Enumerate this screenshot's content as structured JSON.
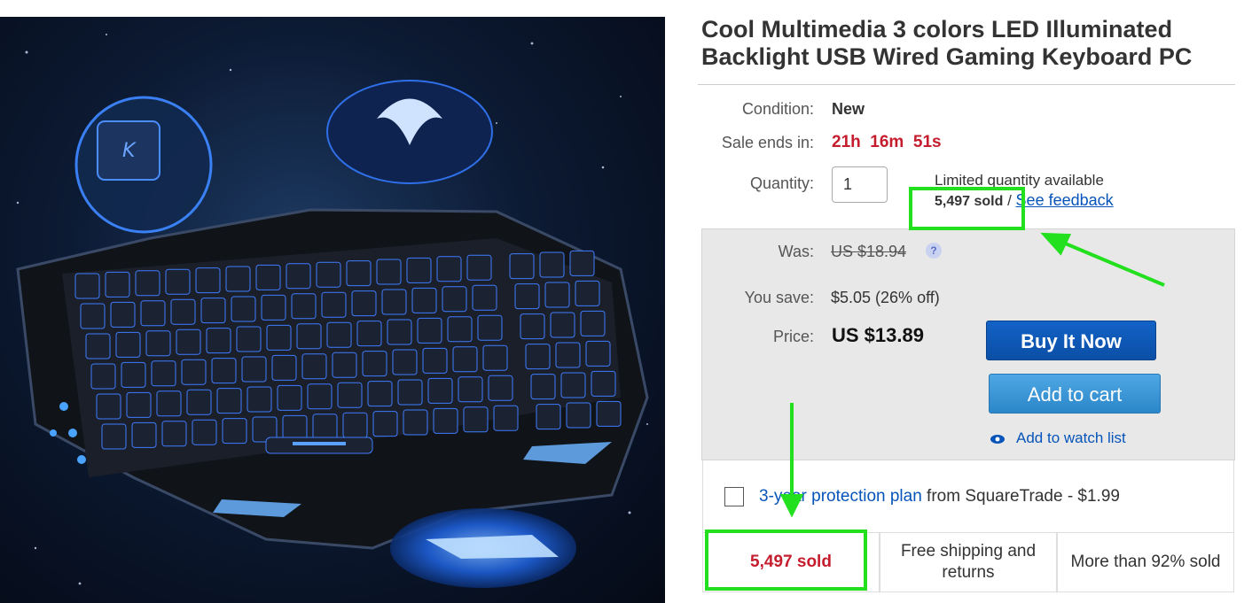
{
  "product": {
    "title": "Cool Multimedia 3 colors LED Illuminated Backlight USB Wired Gaming Keyboard PC"
  },
  "details": {
    "condition_label": "Condition:",
    "condition_value": "New",
    "sale_label": "Sale ends in:",
    "sale_countdown": "21h  16m  51s",
    "quantity_label": "Quantity:",
    "quantity_value": "1",
    "availability_text": "Limited quantity available",
    "sold_count": "5,497 sold",
    "sold_separator": " / ",
    "see_feedback": "See feedback"
  },
  "pricing": {
    "was_label": "Was:",
    "was_price": "US $18.94",
    "help_icon": "question-icon",
    "save_label": "You save:",
    "save_value": "$5.05 (26% off)",
    "price_label": "Price:",
    "price_value": "US $13.89",
    "buy_now": "Buy It Now",
    "add_to_cart": "Add to cart",
    "watch_list": "Add to watch list",
    "watch_icon": "eye-icon"
  },
  "protection": {
    "link_text": "3-year protection plan",
    "suffix": " from SquareTrade - $1.99",
    "checked": false
  },
  "stats": {
    "sold": "5,497 sold",
    "shipping": "Free shipping and returns",
    "percent_sold": "More than 92% sold"
  },
  "colors": {
    "accent_red": "#c51d2d",
    "link_blue": "#0654ba",
    "annotation_green": "#23e01f"
  }
}
